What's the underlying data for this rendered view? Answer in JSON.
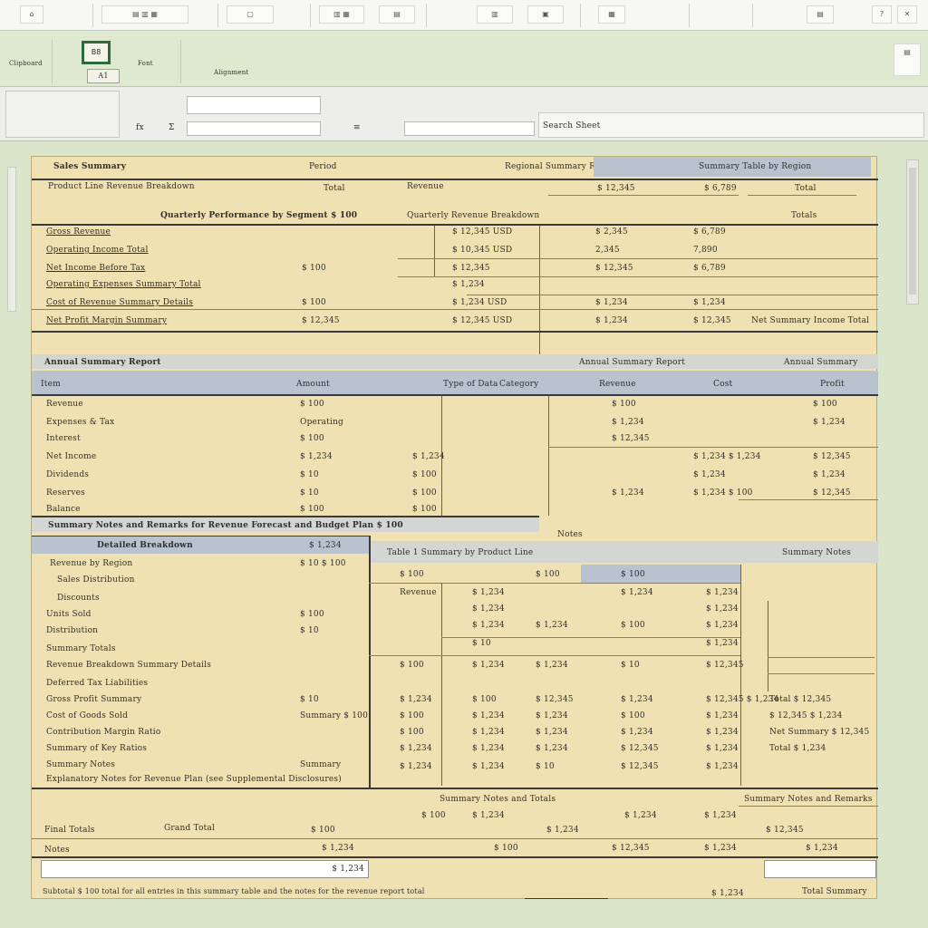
{
  "toolbar": {
    "buttons": [
      "⌂",
      "▤ ▥ ▦",
      "▢",
      "▥ ▦",
      "▤",
      "▥",
      "▣",
      "▦",
      "▤",
      "?",
      "✕"
    ]
  },
  "ribbon": {
    "cell_ref": "B8",
    "name_box": "A1",
    "group_labels": [
      "Clipboard",
      "Font",
      "Alignment"
    ]
  },
  "formula_bar": {
    "labels": [
      "fx",
      "Σ",
      "≡"
    ],
    "search_label": "Search Sheet"
  },
  "sheet": {
    "header_row": {
      "left_label": "Sales Summary",
      "mid_label": "Period",
      "right_label_1": "Regional Summary Report",
      "right_label_2": "Summary Table by Region",
      "col_a": "Product Line Revenue Breakdown",
      "col_b": "Total",
      "col_c": "Revenue",
      "col_d": "$ 12,345",
      "col_e": "$ 6,789",
      "col_f": "Total"
    },
    "section1": {
      "title": "Quarterly Performance by Segment $ 100",
      "subtitle": "Quarterly Revenue Breakdown",
      "right_title": "Totals",
      "rows": [
        {
          "label": "Gross Revenue",
          "v1": "",
          "v2": "$ 12,345 USD",
          "v3": "$ 2,345",
          "v4": "$ 6,789"
        },
        {
          "label": "Operating Income Total",
          "v1": "",
          "v2": "$ 10,345 USD",
          "v3": "2,345",
          "v4": "7,890"
        },
        {
          "label": "Net Income Before Tax",
          "v1": "$ 100",
          "v2": "$ 12,345",
          "v3": "$ 12,345",
          "v4": "$ 6,789"
        },
        {
          "label": "Operating Expenses Summary Total",
          "v1": "",
          "v2": "$ 1,234",
          "v3": "",
          "v4": ""
        },
        {
          "label": "Cost of Revenue Summary Details",
          "v1": "$ 100",
          "v2": "$ 1,234 USD",
          "v3": "$ 1,234",
          "v4": "$ 1,234"
        },
        {
          "label": "Net Profit Margin Summary",
          "v1": "$ 12,345",
          "v2": "$ 12,345 USD",
          "v3": "$ 1,234",
          "v4": "$ 12,345",
          "v5": "Net Summary Income Total"
        }
      ]
    },
    "section2": {
      "title": "Annual Summary Report",
      "right_title": "Annual Summary",
      "col_labels": [
        "Item",
        "Amount",
        "Type of Data",
        "Category",
        "Revenue",
        "Cost",
        "Profit"
      ],
      "rows": [
        {
          "label": "Revenue",
          "a": "$ 100",
          "b": "",
          "c": "$ 100",
          "d": "",
          "e": "$ 100"
        },
        {
          "label": "Expenses & Tax",
          "a": "Operating",
          "b": "",
          "c": "$ 1,234",
          "d": "",
          "e": "$ 1,234"
        },
        {
          "label": "Interest",
          "a": "$ 100",
          "b": "",
          "c": "$ 12,345",
          "d": "",
          "e": ""
        },
        {
          "label": "Net Income",
          "a": "$ 1,234",
          "b": "$ 1,234",
          "c": "",
          "d": "$ 1,234 $ 1,234",
          "e": "$ 12,345"
        },
        {
          "label": "Dividends",
          "a": "$ 10",
          "b": "$ 100",
          "c": "",
          "d": "$ 1,234",
          "e": "$ 1,234"
        },
        {
          "label": "Reserves",
          "a": "$ 10",
          "b": "$ 100",
          "c": "$ 1,234",
          "d": "$ 1,234 $ 100",
          "e": "$ 12,345"
        },
        {
          "label": "Balance",
          "a": "$ 100",
          "b": "$ 100",
          "c": "",
          "d": "",
          "e": ""
        }
      ]
    },
    "section3": {
      "banner": "Summary Notes and Remarks for Revenue Forecast and Budget Plan $ 100",
      "subbanner": "Notes",
      "title": "Detailed Breakdown",
      "title_val": "$ 1,234",
      "mid_title": "Table 1 Summary by Product Line",
      "right_title": "Summary Notes",
      "rows": [
        {
          "label": "Revenue by Region",
          "v": "$ 10 $ 100"
        },
        {
          "label": "Sales Distribution",
          "v": ""
        },
        {
          "label": "Discounts",
          "v": ""
        },
        {
          "label": "Units Sold",
          "v": "$ 100"
        },
        {
          "label": "Distribution",
          "v": "$ 10"
        },
        {
          "label": "Summary Totals",
          "v": ""
        },
        {
          "label": "Revenue Breakdown Summary Details",
          "v": ""
        },
        {
          "label": "Deferred Tax Liabilities",
          "v": ""
        },
        {
          "label": "Gross Profit Summary",
          "v": "$ 10"
        },
        {
          "label": "Cost of Goods Sold",
          "v": "Summary $ 100"
        },
        {
          "label": "Contribution Margin Ratio",
          "v": ""
        },
        {
          "label": "Summary of Key Ratios",
          "v": ""
        },
        {
          "label": "Summary Notes",
          "v": "Summary"
        },
        {
          "label": "Explanatory Notes for Revenue Plan (see Supplemental Disclosures)",
          "v": ""
        }
      ],
      "grid": [
        [
          "$ 100",
          "",
          "$ 100",
          "$ 100"
        ],
        [
          "Revenue",
          "$ 1,234",
          "",
          "$ 1,234",
          "$ 1,234"
        ],
        [
          "",
          "$ 1,234",
          "",
          "",
          "$ 1,234"
        ],
        [
          "",
          "$ 1,234",
          "$ 1,234",
          "$ 100",
          "$ 1,234"
        ],
        [
          "",
          "$ 10",
          "",
          "",
          "$ 1,234"
        ],
        [
          "$ 100",
          "$ 1,234",
          "$ 1,234",
          "$ 10",
          "$ 12,345"
        ],
        [
          "$ 1,234",
          "$ 100",
          "$ 12,345",
          "$ 1,234",
          "$ 12,345 $ 1,234"
        ],
        [
          "$ 100",
          "$ 1,234",
          "$ 1,234",
          "$ 100",
          "$ 1,234"
        ],
        [
          "$ 100",
          "$ 1,234",
          "$ 1,234",
          "$ 1,234",
          "$ 1,234"
        ],
        [
          "$ 1,234",
          "$ 1,234",
          "$ 1,234",
          "$ 12,345",
          "$ 1,234"
        ],
        [
          "$ 1,234",
          "$ 1,234",
          "$ 10",
          "$ 12,345",
          "$ 1,234"
        ]
      ],
      "right_rows": [
        "Total $ 12,345",
        "$ 12,345 $ 1,234",
        "Net Summary $ 12,345",
        "Total $ 1,234"
      ]
    },
    "footer": {
      "banner": "Summary Notes and Totals",
      "right_banner": "Summary Notes and Remarks",
      "row1_label": "Final Totals",
      "row1_mid": "Grand Total",
      "row1_vals": [
        "$ 100",
        "$ 100",
        "$ 1,234",
        "$ 1,234",
        "$ 1,234",
        "$ 1,234",
        "$ 12,345"
      ],
      "row2_label": "Notes",
      "row2_vals": [
        "$ 1,234",
        "$ 100",
        "$ 12,345",
        "$ 1,234",
        "$ 1,234"
      ],
      "input_value": "$ 1,234",
      "note_left": "Subtotal $ 100 total for all entries in this summary table and the notes for the revenue report total",
      "note_right_val": "$ 1,234",
      "note_right": "Total Summary"
    }
  }
}
